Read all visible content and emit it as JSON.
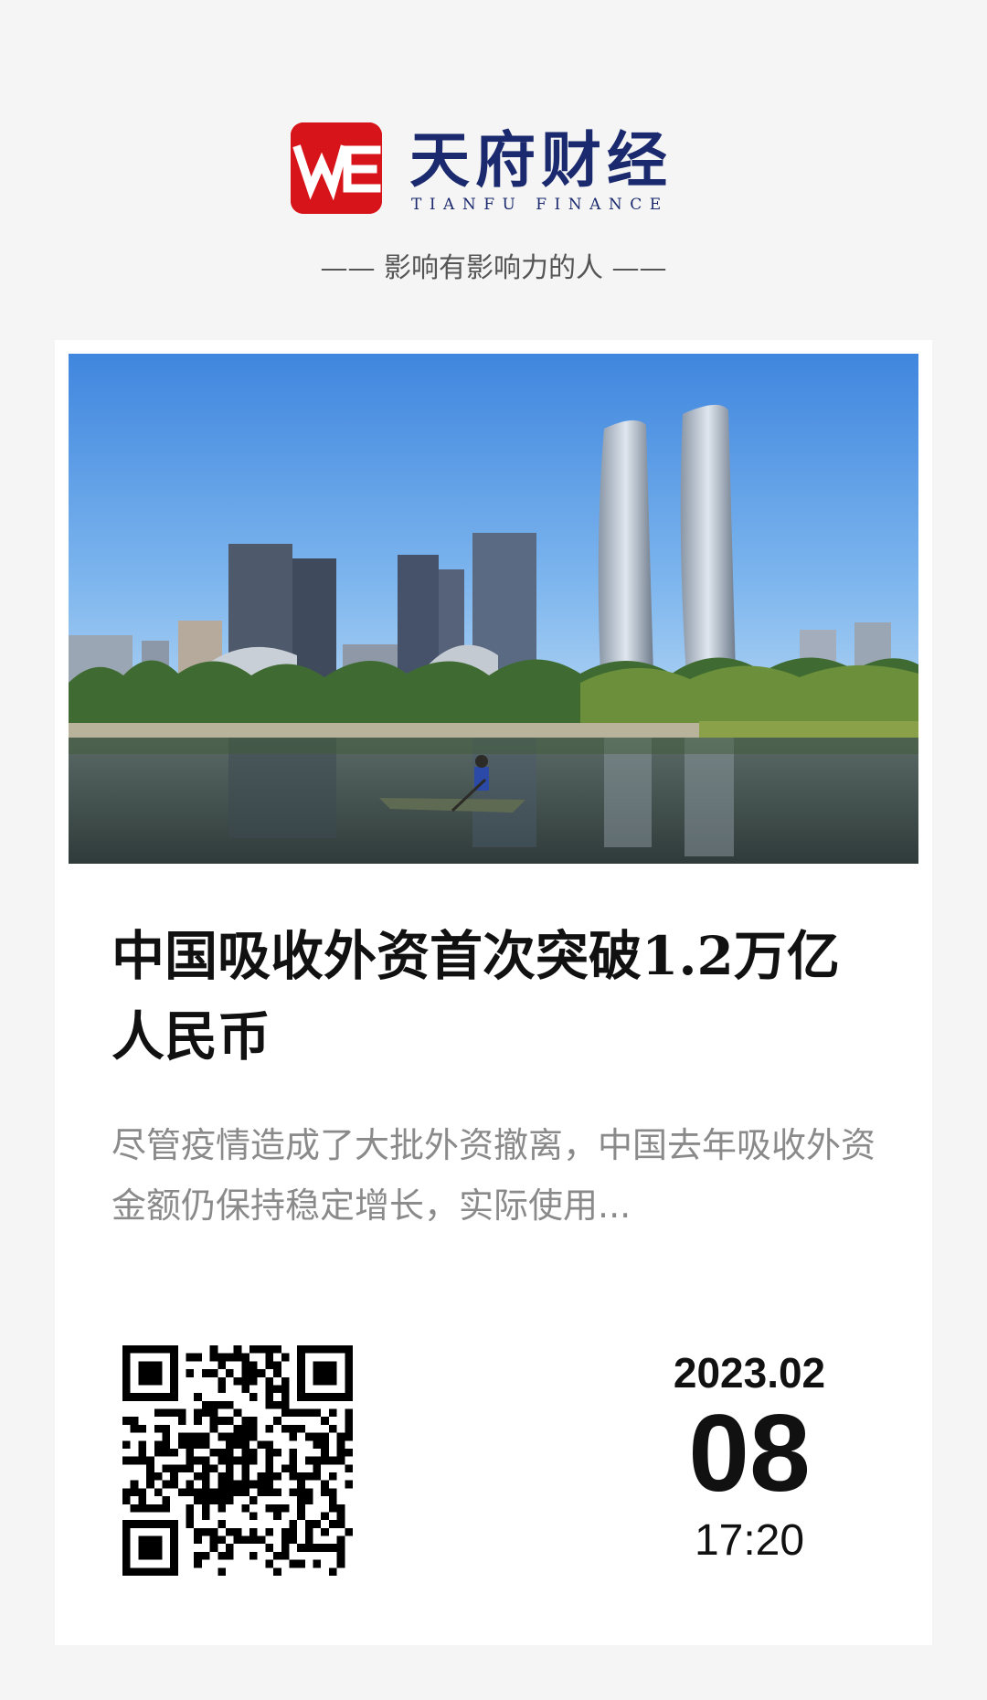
{
  "brand": {
    "logo_text": "WE",
    "name": "天府财经",
    "subtitle": "TIANFU FINANCE",
    "color": "#1b2a6e",
    "logo_color": "#d7141a"
  },
  "slogan": "—— 影响有影响力的人 ——",
  "article": {
    "headline": "中国吸收外资首次突破1.2万亿人民币",
    "summary": "尽管疫情造成了大批外资撤离，中国去年吸收外资金额仍保持稳定增长，实际使用...",
    "image_icon": "city-skyline-photo"
  },
  "qr_code": {
    "icon": "qr-code-icon"
  },
  "date": {
    "year_month": "2023.02",
    "day": "08",
    "time": "17:20"
  }
}
